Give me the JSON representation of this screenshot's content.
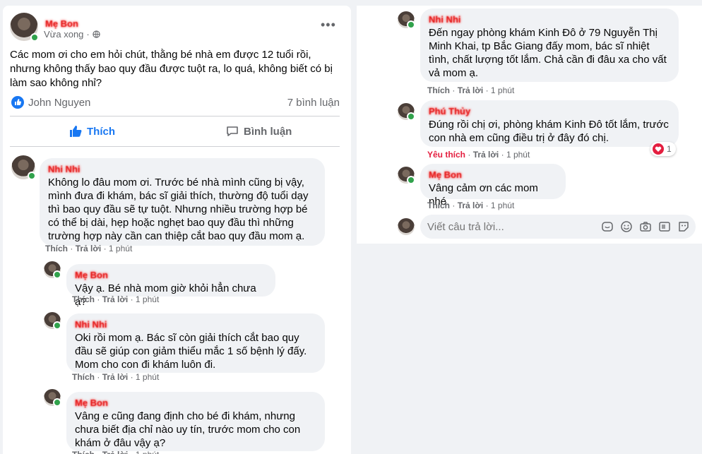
{
  "post": {
    "author": "Mẹ Bon",
    "time": "Vừa xong",
    "text": "Các mom ơi cho em hỏi chút, thằng bé nhà em được 12 tuổi rồi, nhưng không thấy bao quy đầu được tuột ra, lo quá, không biết có bị làm sao không nhỉ?",
    "reactor": "John Nguyen",
    "comment_count": "7 bình luận",
    "like_label": "Thích",
    "comment_label": "Bình luận"
  },
  "actions": {
    "like": "Thích",
    "reply": "Trả lời",
    "time": "1 phút",
    "liked": "Yêu thích",
    "sep": "·"
  },
  "comments_left": [
    {
      "author": "Nhi Nhi",
      "text": "Không lo đâu mom ơi. Trước bé nhà mình cũng bị vậy, mình đưa đi khám, bác sĩ giải thích, thường độ tuổi dạy thì bao quy đầu sẽ tự tuột. Nhưng nhiều trường hợp bé có thể bị dài, hẹp hoặc nghẹt bao quy đầu thì những trường hợp này cần can thiệp cắt bao quy đầu mom ạ."
    },
    {
      "author": "Mẹ Bon",
      "text": "Vậy ạ. Bé nhà mom giờ khỏi hẳn chưa ạ?"
    },
    {
      "author": "Nhi Nhi",
      "text": "Oki rồi mom ạ. Bác sĩ còn giải thích cắt bao quy đầu sẽ giúp con giảm thiểu mắc 1 số bệnh lý đấy. Mom cho con đi khám luôn đi."
    },
    {
      "author": "Mẹ Bon",
      "text": "Vâng e cũng đang định cho bé đi khám, nhưng chưa biết địa chỉ nào uy tín, trước mom cho con khám ở đâu vậy ạ?"
    }
  ],
  "comments_right": [
    {
      "author": "Nhi Nhi",
      "text": "Đến ngay phòng khám Kinh Đô ở 79 Nguyễn Thị Minh Khai, tp Bắc Giang đấy mom, bác sĩ nhiệt tình, chất lượng tốt lắm. Chả cần đi đâu xa cho vất vả mom ạ."
    },
    {
      "author": "Phú Thủy",
      "text": "Đúng rồi chị ơi, phòng khám Kinh Đô tốt lắm, trước con nhà em cũng điều trị ở đây đó chị.",
      "reaction_count": "1"
    },
    {
      "author": "Mẹ Bon",
      "text": "Vâng cảm ơn các mom nhé."
    }
  ],
  "reply_input": {
    "placeholder": "Viết câu trả lời..."
  },
  "icons": [
    "more-icon",
    "globe-icon",
    "like-icon",
    "comment-icon",
    "heart-icon",
    "sticker-icon",
    "emoji-icon",
    "camera-icon",
    "gif-icon",
    "stickers-icon"
  ],
  "colors": {
    "like_blue": "#1877f2",
    "reaction_red": "#e41e3f",
    "online_green": "#31a24c"
  }
}
